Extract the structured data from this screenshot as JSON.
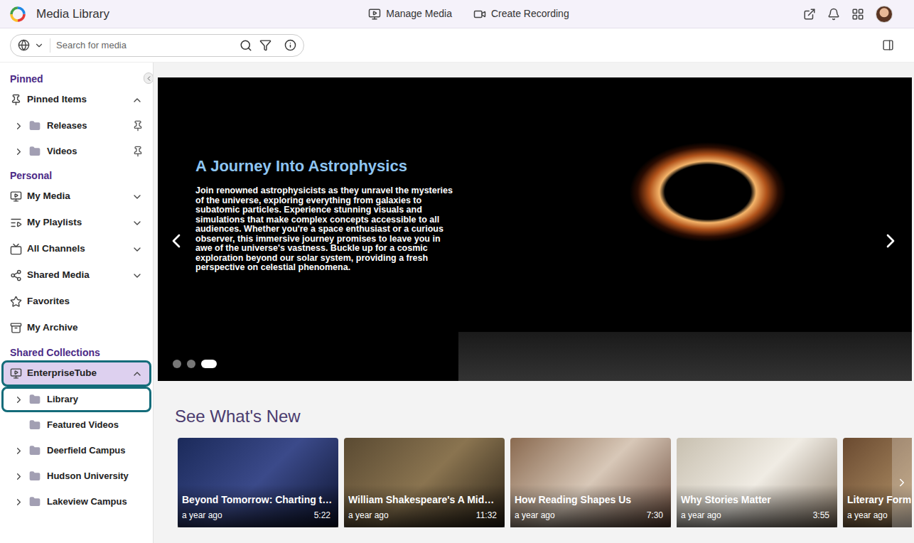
{
  "app": {
    "title": "Media Library"
  },
  "nav": [
    {
      "label": "Manage Media"
    },
    {
      "label": "Create Recording"
    }
  ],
  "search": {
    "placeholder": "Search for media"
  },
  "sidebar": {
    "sections": [
      {
        "title": "Pinned",
        "items": [
          {
            "label": "Pinned Items",
            "kind": "group",
            "expandable": true,
            "expanded": true,
            "pinned": false,
            "selected": false,
            "highlighted": false
          },
          {
            "label": "Releases",
            "kind": "folder",
            "expandable": true,
            "expanded": false,
            "pinned": true,
            "selected": false,
            "highlighted": false
          },
          {
            "label": "Videos",
            "kind": "folder",
            "expandable": true,
            "expanded": false,
            "pinned": true,
            "selected": false,
            "highlighted": false
          }
        ]
      },
      {
        "title": "Personal",
        "items": [
          {
            "label": "My Media",
            "kind": "group",
            "expandable": true,
            "expanded": false,
            "pinned": false,
            "selected": false,
            "highlighted": false
          },
          {
            "label": "My Playlists",
            "kind": "group",
            "expandable": true,
            "expanded": false,
            "pinned": false,
            "selected": false,
            "highlighted": false
          },
          {
            "label": "All Channels",
            "kind": "group",
            "expandable": true,
            "expanded": false,
            "pinned": false,
            "selected": false,
            "highlighted": false
          },
          {
            "label": "Shared Media",
            "kind": "group",
            "expandable": true,
            "expanded": false,
            "pinned": false,
            "selected": false,
            "highlighted": false
          },
          {
            "label": "Favorites",
            "kind": "group",
            "expandable": false,
            "expanded": false,
            "pinned": false,
            "selected": false,
            "highlighted": false
          },
          {
            "label": "My Archive",
            "kind": "group",
            "expandable": false,
            "expanded": false,
            "pinned": false,
            "selected": false,
            "highlighted": false
          }
        ]
      },
      {
        "title": "Shared Collections",
        "items": [
          {
            "label": "EnterpriseTube",
            "kind": "group",
            "expandable": true,
            "expanded": true,
            "pinned": false,
            "selected": true,
            "highlighted": true
          },
          {
            "label": "Library",
            "kind": "folder",
            "expandable": true,
            "expanded": false,
            "pinned": false,
            "selected": false,
            "highlighted": true
          },
          {
            "label": "Featured Videos",
            "kind": "folder",
            "expandable": false,
            "expanded": false,
            "pinned": false,
            "selected": false,
            "highlighted": false
          },
          {
            "label": "Deerfield Campus",
            "kind": "folder",
            "expandable": true,
            "expanded": false,
            "pinned": false,
            "selected": false,
            "highlighted": false
          },
          {
            "label": "Hudson University",
            "kind": "folder",
            "expandable": true,
            "expanded": false,
            "pinned": false,
            "selected": false,
            "highlighted": false
          },
          {
            "label": "Lakeview Campus",
            "kind": "folder",
            "expandable": true,
            "expanded": false,
            "pinned": false,
            "selected": false,
            "highlighted": false
          }
        ]
      }
    ]
  },
  "hero": {
    "title": "A Journey Into Astrophysics",
    "description": "Join renowned astrophysicists as they unravel the mysteries of the universe, exploring everything from galaxies to subatomic particles. Experience stunning visuals and simulations that make complex concepts accessible to all audiences. Whether you're a space enthusiast or a curious observer, this immersive journey promises to leave you in awe of the universe's vastness. Buckle up for a cosmic exploration beyond our solar system, providing a fresh perspective on celestial phenomena.",
    "slides": [
      {
        "selected": false
      },
      {
        "selected": false
      },
      {
        "selected": true
      }
    ]
  },
  "whats_new": {
    "title": "See What's New",
    "cards": [
      {
        "title": "Beyond Tomorrow: Charting t…",
        "time": "a year ago",
        "duration": "5:22"
      },
      {
        "title": "William Shakespeare's A Mid…",
        "time": "a year ago",
        "duration": "11:32"
      },
      {
        "title": "How Reading Shapes Us",
        "time": "a year ago",
        "duration": "7:30"
      },
      {
        "title": "Why Stories Matter",
        "time": "a year ago",
        "duration": "3:55"
      },
      {
        "title": "Literary Form",
        "time": "a year ago"
      }
    ]
  }
}
